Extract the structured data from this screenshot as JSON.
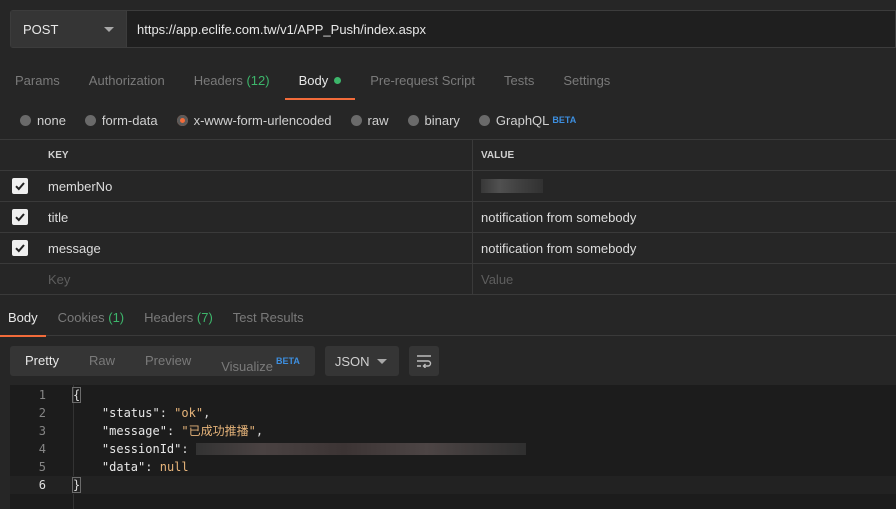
{
  "request": {
    "method": "POST",
    "url": "https://app.eclife.com.tw/v1/APP_Push/index.aspx"
  },
  "request_tabs": [
    {
      "label": "Params",
      "count": ""
    },
    {
      "label": "Authorization",
      "count": ""
    },
    {
      "label": "Headers",
      "count": "(12)"
    },
    {
      "label": "Body",
      "count": "",
      "active": true
    },
    {
      "label": "Pre-request Script",
      "count": ""
    },
    {
      "label": "Tests",
      "count": ""
    },
    {
      "label": "Settings",
      "count": ""
    }
  ],
  "body_types": [
    {
      "label": "none"
    },
    {
      "label": "form-data"
    },
    {
      "label": "x-www-form-urlencoded",
      "selected": true
    },
    {
      "label": "raw"
    },
    {
      "label": "binary"
    },
    {
      "label": "GraphQL",
      "badge": "BETA"
    }
  ],
  "kv_table": {
    "headers": {
      "key": "KEY",
      "value": "VALUE"
    },
    "rows": [
      {
        "key": "memberNo",
        "value": "",
        "checked": true,
        "redacted": true
      },
      {
        "key": "title",
        "value": "notification from somebody",
        "checked": true
      },
      {
        "key": "message",
        "value": "notification from somebody",
        "checked": true
      }
    ],
    "placeholder": {
      "key": "Key",
      "value": "Value"
    }
  },
  "response_tabs": [
    {
      "label": "Body",
      "count": "",
      "active": true
    },
    {
      "label": "Cookies",
      "count": "(1)"
    },
    {
      "label": "Headers",
      "count": "(7)"
    },
    {
      "label": "Test Results",
      "count": ""
    }
  ],
  "view_modes": [
    {
      "label": "Pretty",
      "active": true
    },
    {
      "label": "Raw"
    },
    {
      "label": "Preview"
    },
    {
      "label": "Visualize",
      "badge": "BETA"
    }
  ],
  "format_select": "JSON",
  "code_lines": [
    {
      "num": "1",
      "text": "{"
    },
    {
      "num": "2",
      "key": "\"status\"",
      "val": "\"ok\"",
      "trail": ","
    },
    {
      "num": "3",
      "key": "\"message\"",
      "val": "\"已成功推播\"",
      "trail": ","
    },
    {
      "num": "4",
      "key": "\"sessionId\"",
      "val": "",
      "trail": ""
    },
    {
      "num": "5",
      "key": "\"data\"",
      "val": "null",
      "trail": ""
    },
    {
      "num": "6",
      "text": "}"
    }
  ],
  "colors": {
    "accent": "#f26b3a",
    "count_green": "#3db66b",
    "beta_blue": "#3d8fe0"
  }
}
